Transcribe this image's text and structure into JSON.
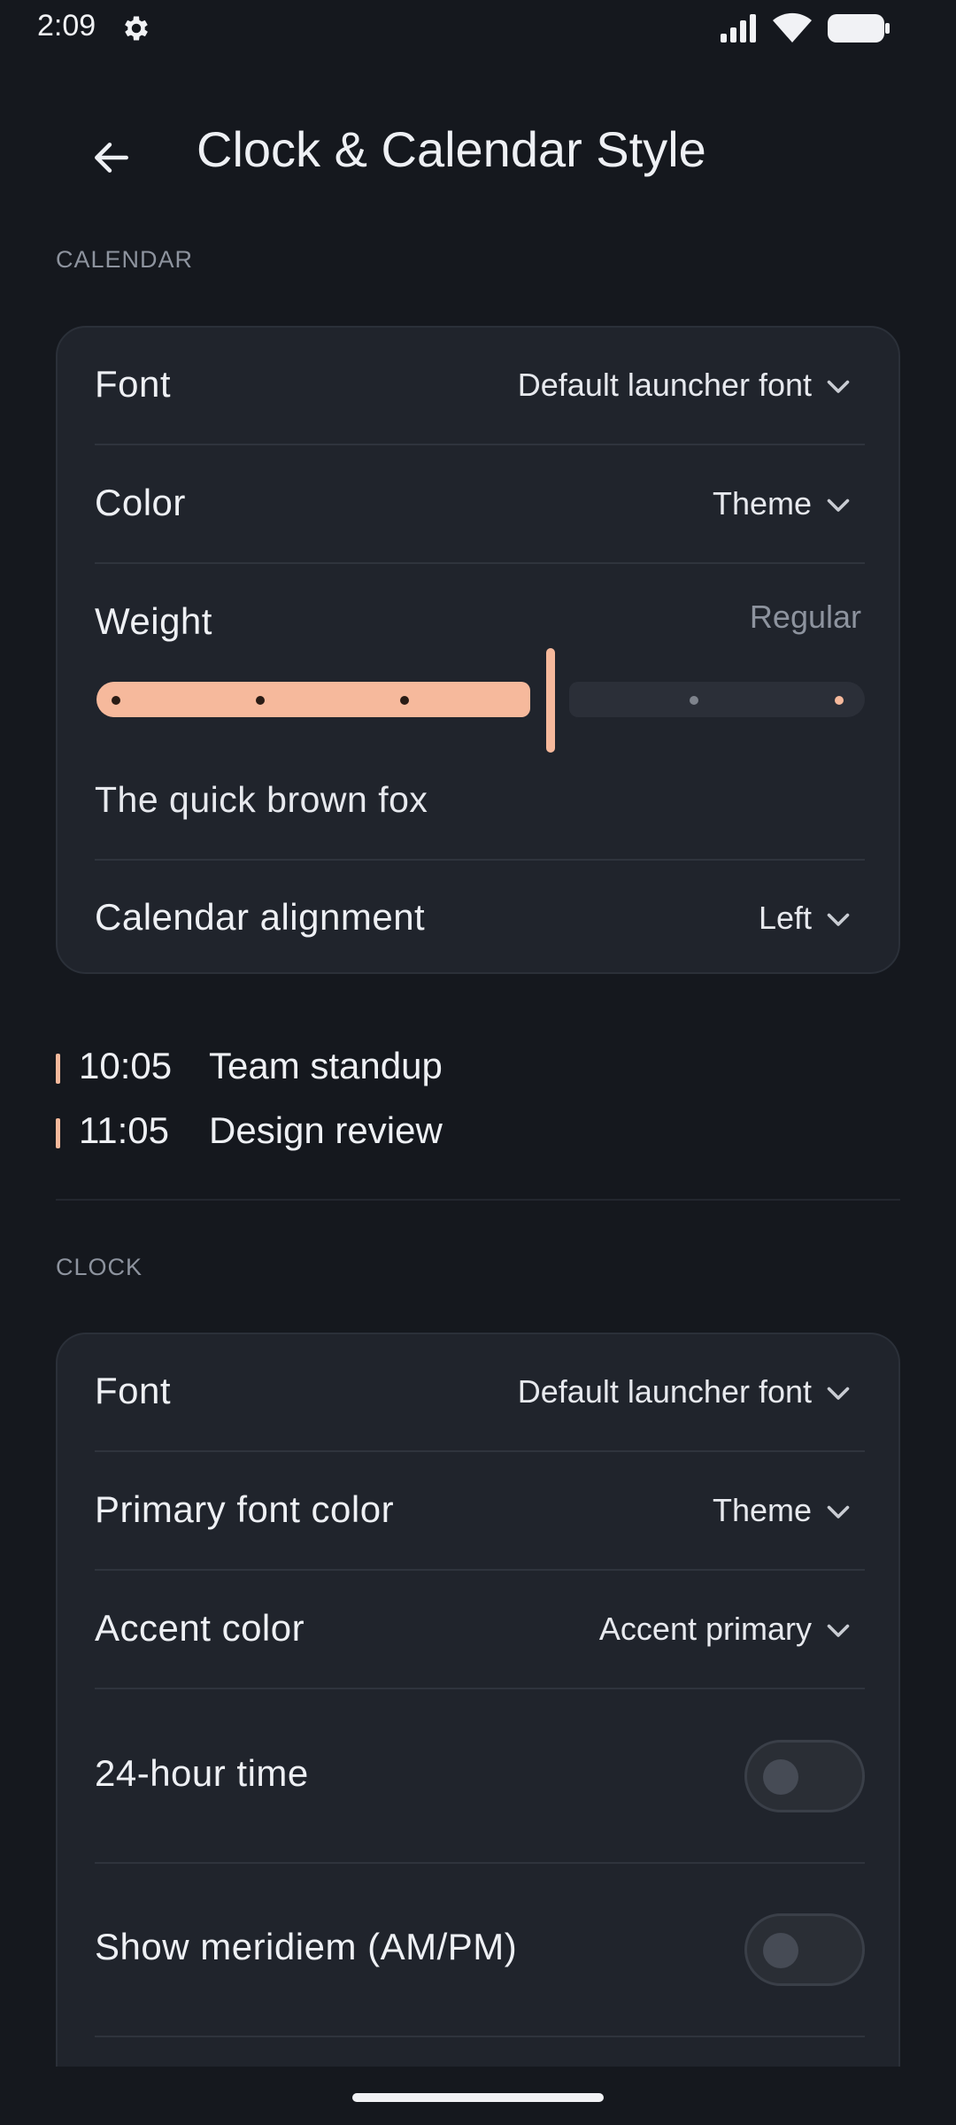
{
  "status": {
    "time": "2:09",
    "icons": [
      "gear-icon",
      "signal-icon",
      "wifi-icon",
      "battery-icon"
    ]
  },
  "header": {
    "title": "Clock & Calendar Style",
    "back_icon": "arrow-left-icon"
  },
  "calendar": {
    "section_label": "CALENDAR",
    "font": {
      "label": "Font",
      "value": "Default launcher font"
    },
    "color": {
      "label": "Color",
      "value": "Theme"
    },
    "weight": {
      "label": "Weight",
      "value": "Regular",
      "level_fraction": 0.6,
      "steps": 5
    },
    "sample_text": "The quick brown fox",
    "alignment": {
      "label": "Calendar alignment",
      "value": "Left"
    }
  },
  "events": [
    {
      "time": "10:05",
      "title": "Team standup"
    },
    {
      "time": "11:05",
      "title": "Design review"
    }
  ],
  "clock": {
    "section_label": "CLOCK",
    "font": {
      "label": "Font",
      "value": "Default launcher font"
    },
    "primary_color": {
      "label": "Primary font color",
      "value": "Theme"
    },
    "accent_color": {
      "label": "Accent color",
      "value": "Accent primary"
    },
    "hour24": {
      "label": "24-hour time",
      "on": false
    },
    "meridiem": {
      "label": "Show meridiem (AM/PM)",
      "on": false
    }
  },
  "colors": {
    "background": "#15181e",
    "card": "#20242c",
    "accent": "#f6b99c",
    "muted_text": "#8d939e"
  }
}
